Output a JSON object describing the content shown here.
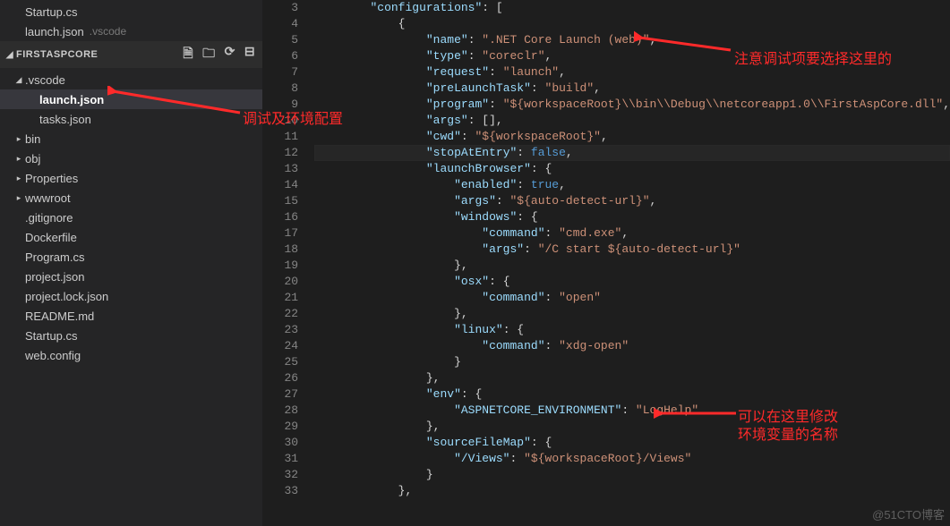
{
  "openEditors": [
    {
      "name": "Startup.cs",
      "path": ""
    },
    {
      "name": "launch.json",
      "path": ".vscode"
    }
  ],
  "explorer": {
    "title": "FIRSTASPCORE",
    "items": [
      {
        "label": ".vscode",
        "depth": 1,
        "type": "folder",
        "expanded": true,
        "selected": false
      },
      {
        "label": "launch.json",
        "depth": 2,
        "type": "file",
        "selected": true
      },
      {
        "label": "tasks.json",
        "depth": 2,
        "type": "file",
        "selected": false
      },
      {
        "label": "bin",
        "depth": 1,
        "type": "folder",
        "expanded": false,
        "selected": false
      },
      {
        "label": "obj",
        "depth": 1,
        "type": "folder",
        "expanded": false,
        "selected": false
      },
      {
        "label": "Properties",
        "depth": 1,
        "type": "folder",
        "expanded": false,
        "selected": false
      },
      {
        "label": "wwwroot",
        "depth": 1,
        "type": "folder",
        "expanded": false,
        "selected": false
      },
      {
        "label": ".gitignore",
        "depth": 1,
        "type": "file",
        "selected": false
      },
      {
        "label": "Dockerfile",
        "depth": 1,
        "type": "file",
        "selected": false
      },
      {
        "label": "Program.cs",
        "depth": 1,
        "type": "file",
        "selected": false
      },
      {
        "label": "project.json",
        "depth": 1,
        "type": "file",
        "selected": false
      },
      {
        "label": "project.lock.json",
        "depth": 1,
        "type": "file",
        "selected": false
      },
      {
        "label": "README.md",
        "depth": 1,
        "type": "file",
        "selected": false
      },
      {
        "label": "Startup.cs",
        "depth": 1,
        "type": "file",
        "selected": false
      },
      {
        "label": "web.config",
        "depth": 1,
        "type": "file",
        "selected": false
      }
    ]
  },
  "code": {
    "startLine": 3,
    "currentLine": 12,
    "lines": [
      {
        "indent": 8,
        "tokens": [
          {
            "t": "pkey",
            "v": "\"configurations\""
          },
          {
            "t": "punc",
            "v": ": ["
          }
        ]
      },
      {
        "indent": 12,
        "tokens": [
          {
            "t": "punc",
            "v": "{"
          }
        ]
      },
      {
        "indent": 16,
        "tokens": [
          {
            "t": "pkey",
            "v": "\"name\""
          },
          {
            "t": "punc",
            "v": ": "
          },
          {
            "t": "str",
            "v": "\".NET Core Launch (web)\""
          },
          {
            "t": "punc",
            "v": ","
          }
        ]
      },
      {
        "indent": 16,
        "tokens": [
          {
            "t": "pkey",
            "v": "\"type\""
          },
          {
            "t": "punc",
            "v": ": "
          },
          {
            "t": "str",
            "v": "\"coreclr\""
          },
          {
            "t": "punc",
            "v": ","
          }
        ]
      },
      {
        "indent": 16,
        "tokens": [
          {
            "t": "pkey",
            "v": "\"request\""
          },
          {
            "t": "punc",
            "v": ": "
          },
          {
            "t": "str",
            "v": "\"launch\""
          },
          {
            "t": "punc",
            "v": ","
          }
        ]
      },
      {
        "indent": 16,
        "tokens": [
          {
            "t": "pkey",
            "v": "\"preLaunchTask\""
          },
          {
            "t": "punc",
            "v": ": "
          },
          {
            "t": "str",
            "v": "\"build\""
          },
          {
            "t": "punc",
            "v": ","
          }
        ]
      },
      {
        "indent": 16,
        "tokens": [
          {
            "t": "pkey",
            "v": "\"program\""
          },
          {
            "t": "punc",
            "v": ": "
          },
          {
            "t": "str",
            "v": "\"${workspaceRoot}\\\\bin\\\\Debug\\\\netcoreapp1.0\\\\FirstAspCore.dll\""
          },
          {
            "t": "punc",
            "v": ","
          }
        ]
      },
      {
        "indent": 16,
        "tokens": [
          {
            "t": "pkey",
            "v": "\"args\""
          },
          {
            "t": "punc",
            "v": ": [],"
          }
        ]
      },
      {
        "indent": 16,
        "tokens": [
          {
            "t": "pkey",
            "v": "\"cwd\""
          },
          {
            "t": "punc",
            "v": ": "
          },
          {
            "t": "str",
            "v": "\"${workspaceRoot}\""
          },
          {
            "t": "punc",
            "v": ","
          }
        ]
      },
      {
        "indent": 16,
        "tokens": [
          {
            "t": "pkey",
            "v": "\"stopAtEntry\""
          },
          {
            "t": "punc",
            "v": ": "
          },
          {
            "t": "kw",
            "v": "false"
          },
          {
            "t": "punc",
            "v": ","
          }
        ]
      },
      {
        "indent": 16,
        "tokens": [
          {
            "t": "pkey",
            "v": "\"launchBrowser\""
          },
          {
            "t": "punc",
            "v": ": {"
          }
        ]
      },
      {
        "indent": 20,
        "tokens": [
          {
            "t": "pkey",
            "v": "\"enabled\""
          },
          {
            "t": "punc",
            "v": ": "
          },
          {
            "t": "kw",
            "v": "true"
          },
          {
            "t": "punc",
            "v": ","
          }
        ]
      },
      {
        "indent": 20,
        "tokens": [
          {
            "t": "pkey",
            "v": "\"args\""
          },
          {
            "t": "punc",
            "v": ": "
          },
          {
            "t": "str",
            "v": "\"${auto-detect-url}\""
          },
          {
            "t": "punc",
            "v": ","
          }
        ]
      },
      {
        "indent": 20,
        "tokens": [
          {
            "t": "pkey",
            "v": "\"windows\""
          },
          {
            "t": "punc",
            "v": ": {"
          }
        ]
      },
      {
        "indent": 24,
        "tokens": [
          {
            "t": "pkey",
            "v": "\"command\""
          },
          {
            "t": "punc",
            "v": ": "
          },
          {
            "t": "str",
            "v": "\"cmd.exe\""
          },
          {
            "t": "punc",
            "v": ","
          }
        ]
      },
      {
        "indent": 24,
        "tokens": [
          {
            "t": "pkey",
            "v": "\"args\""
          },
          {
            "t": "punc",
            "v": ": "
          },
          {
            "t": "str",
            "v": "\"/C start ${auto-detect-url}\""
          }
        ]
      },
      {
        "indent": 20,
        "tokens": [
          {
            "t": "punc",
            "v": "},"
          }
        ]
      },
      {
        "indent": 20,
        "tokens": [
          {
            "t": "pkey",
            "v": "\"osx\""
          },
          {
            "t": "punc",
            "v": ": {"
          }
        ]
      },
      {
        "indent": 24,
        "tokens": [
          {
            "t": "pkey",
            "v": "\"command\""
          },
          {
            "t": "punc",
            "v": ": "
          },
          {
            "t": "str",
            "v": "\"open\""
          }
        ]
      },
      {
        "indent": 20,
        "tokens": [
          {
            "t": "punc",
            "v": "},"
          }
        ]
      },
      {
        "indent": 20,
        "tokens": [
          {
            "t": "pkey",
            "v": "\"linux\""
          },
          {
            "t": "punc",
            "v": ": {"
          }
        ]
      },
      {
        "indent": 24,
        "tokens": [
          {
            "t": "pkey",
            "v": "\"command\""
          },
          {
            "t": "punc",
            "v": ": "
          },
          {
            "t": "str",
            "v": "\"xdg-open\""
          }
        ]
      },
      {
        "indent": 20,
        "tokens": [
          {
            "t": "punc",
            "v": "}"
          }
        ]
      },
      {
        "indent": 16,
        "tokens": [
          {
            "t": "punc",
            "v": "},"
          }
        ]
      },
      {
        "indent": 16,
        "tokens": [
          {
            "t": "pkey",
            "v": "\"env\""
          },
          {
            "t": "punc",
            "v": ": {"
          }
        ]
      },
      {
        "indent": 20,
        "tokens": [
          {
            "t": "pkey",
            "v": "\"ASPNETCORE_ENVIRONMENT\""
          },
          {
            "t": "punc",
            "v": ": "
          },
          {
            "t": "str",
            "v": "\"LogHelp\""
          }
        ]
      },
      {
        "indent": 16,
        "tokens": [
          {
            "t": "punc",
            "v": "},"
          }
        ]
      },
      {
        "indent": 16,
        "tokens": [
          {
            "t": "pkey",
            "v": "\"sourceFileMap\""
          },
          {
            "t": "punc",
            "v": ": {"
          }
        ]
      },
      {
        "indent": 20,
        "tokens": [
          {
            "t": "pkey",
            "v": "\"/Views\""
          },
          {
            "t": "punc",
            "v": ": "
          },
          {
            "t": "str",
            "v": "\"${workspaceRoot}/Views\""
          }
        ]
      },
      {
        "indent": 16,
        "tokens": [
          {
            "t": "punc",
            "v": "}"
          }
        ]
      },
      {
        "indent": 12,
        "tokens": [
          {
            "t": "punc",
            "v": "},"
          }
        ]
      }
    ]
  },
  "annotations": {
    "a1": "注意调试项要选择这里的",
    "a2": "调试及环境配置",
    "a3a": "可以在这里修改",
    "a3b": "环境变量的名称"
  },
  "watermark": "@51CTO博客"
}
